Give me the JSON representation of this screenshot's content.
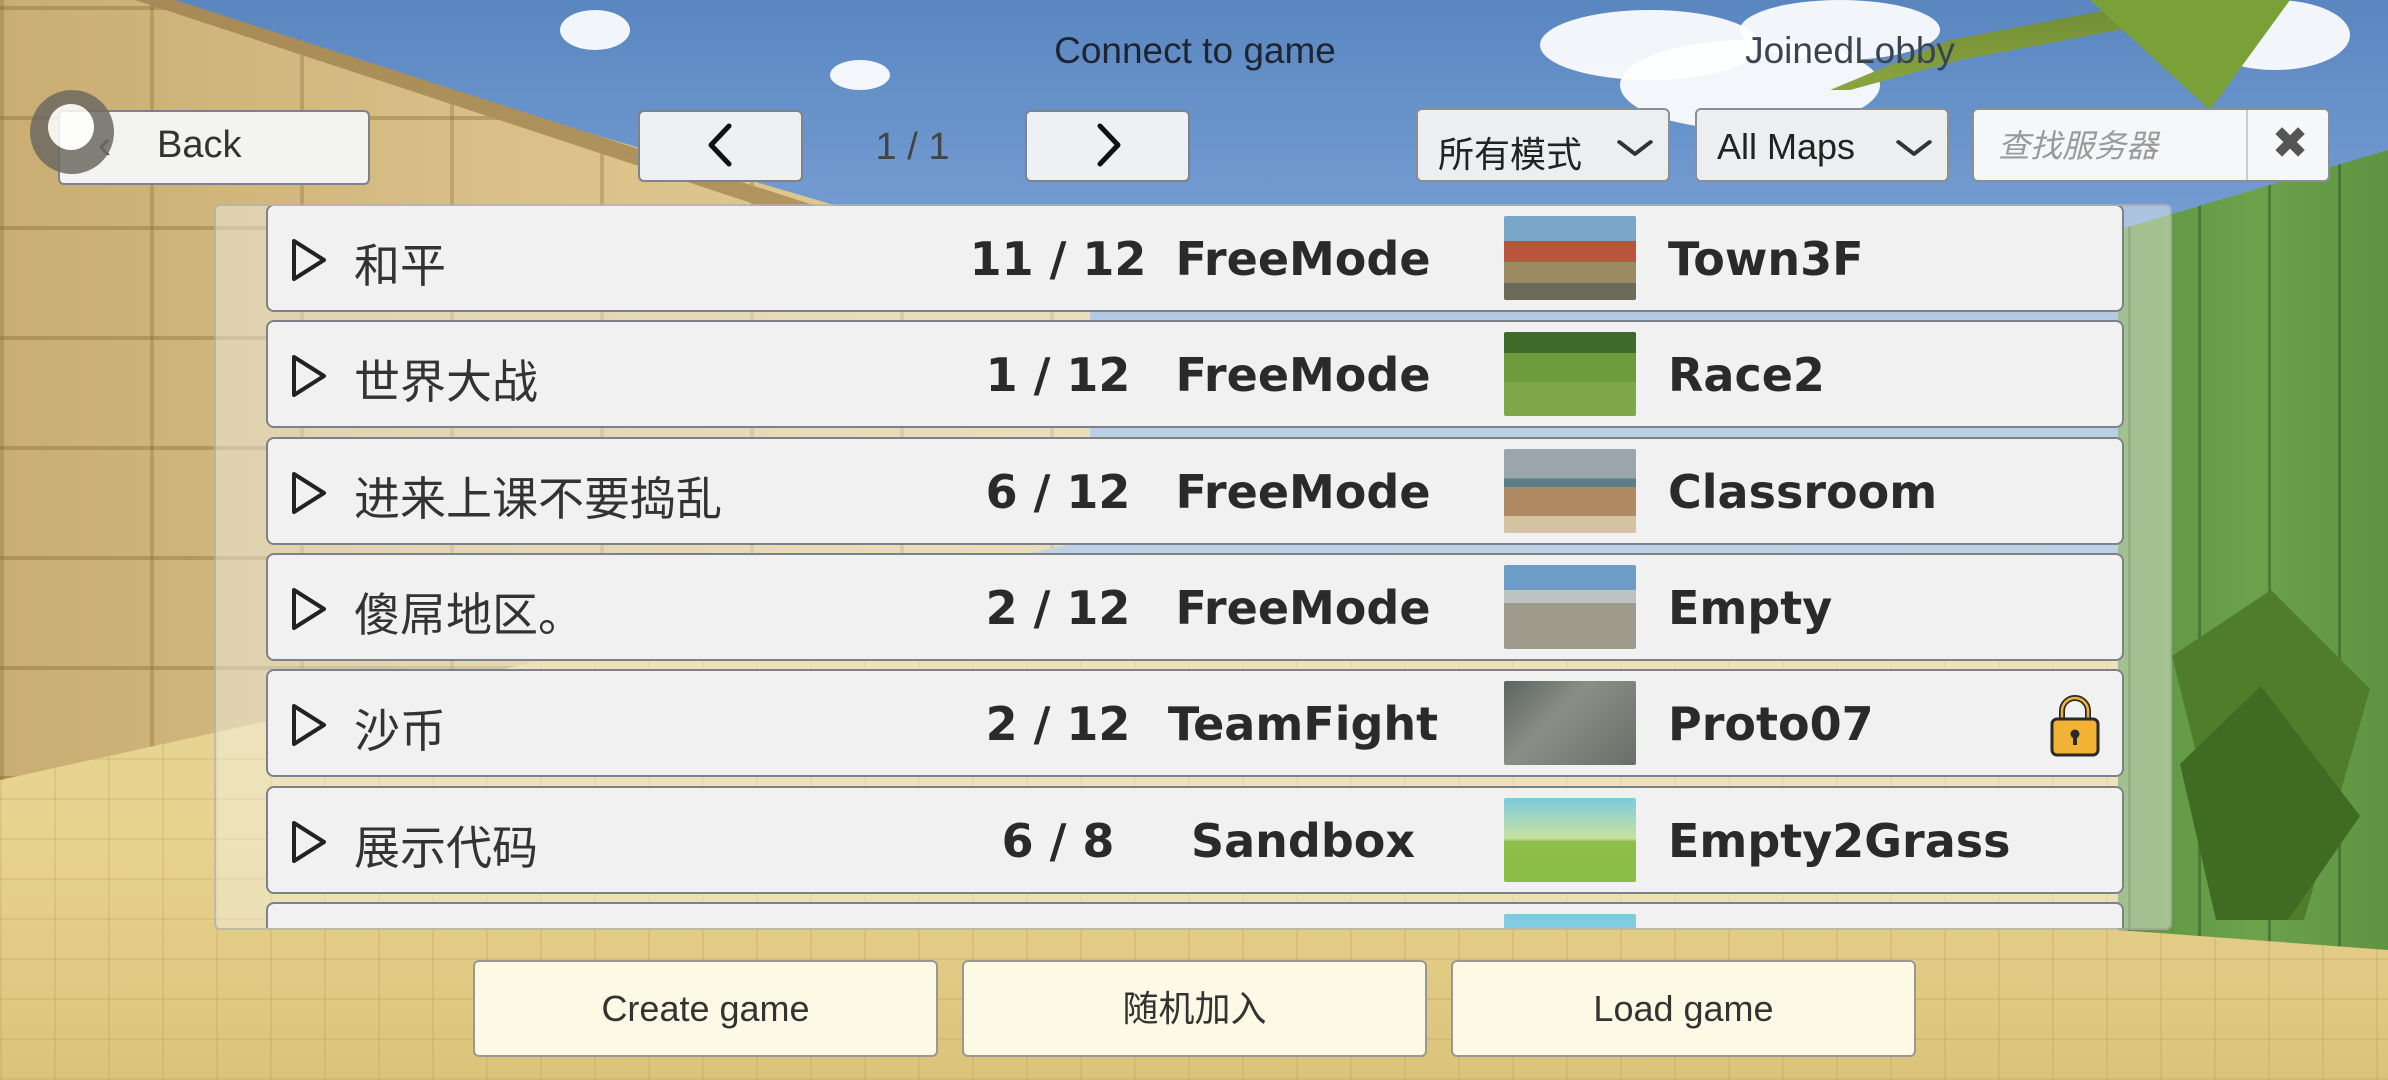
{
  "header": {
    "title": "Connect to game",
    "status": "JoinedLobby"
  },
  "back_button": {
    "label": "Back",
    "icon": "chevron-left-icon"
  },
  "pagination": {
    "prev_icon": "chevron-left-icon",
    "next_icon": "chevron-right-icon",
    "page_text": "1 / 1"
  },
  "filters": {
    "mode_selected": "所有模式",
    "map_selected": "All Maps",
    "dropdown_icon": "chevron-down-icon"
  },
  "search": {
    "placeholder": "查找服务器",
    "value": "",
    "clear_icon": "close-icon"
  },
  "servers": [
    {
      "name": "和平",
      "players": "11 / 12",
      "mode": "FreeMode",
      "map": "Town3F",
      "locked": false
    },
    {
      "name": "世界大战",
      "players": "1 / 12",
      "mode": "FreeMode",
      "map": "Race2",
      "locked": false
    },
    {
      "name": "进来上课不要捣乱",
      "players": "6 / 12",
      "mode": "FreeMode",
      "map": "Classroom",
      "locked": false
    },
    {
      "name": "傻屌地区。",
      "players": "2 / 12",
      "mode": "FreeMode",
      "map": "Empty",
      "locked": false
    },
    {
      "name": "沙币",
      "players": "2 / 12",
      "mode": "TeamFight",
      "map": "Proto07",
      "locked": true
    },
    {
      "name": "展示代码",
      "players": "6 / 8",
      "mode": "Sandbox",
      "map": "Empty2Grass",
      "locked": false
    }
  ],
  "actions": {
    "create": "Create game",
    "random": "随机加入",
    "load": "Load game"
  },
  "colors": {
    "row_bg": "#f1f1f1",
    "row_border": "#7d828a",
    "action_bg": "#fcf9e5",
    "lock": "#f2b233"
  }
}
